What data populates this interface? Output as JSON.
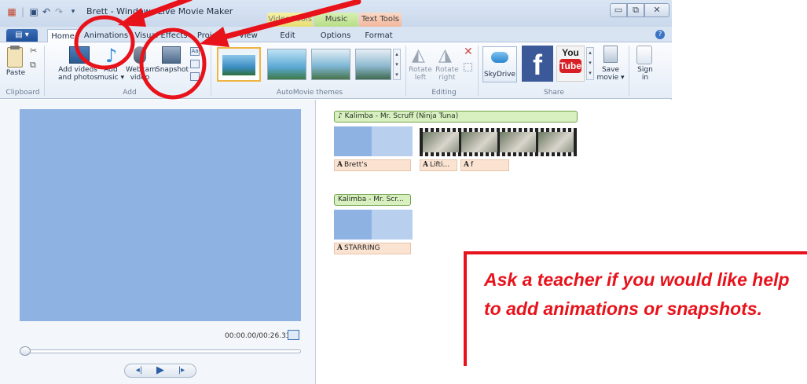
{
  "window": {
    "title": "Brett - Windows Live Movie Maker",
    "context_tabs": [
      "Video Tools",
      "Music Tools",
      "Text Tools"
    ],
    "tabs": [
      "Home",
      "Animations",
      "Visual Effects",
      "Project",
      "View",
      "Edit",
      "Options",
      "Format"
    ],
    "active_tab": "Home"
  },
  "ribbon": {
    "clipboard": {
      "paste": "Paste",
      "group": "Clipboard"
    },
    "add": {
      "add_videos": "Add videos\nand photos",
      "add_music": "Add\nmusic ▾",
      "webcam": "Webcam\nvideo",
      "snapshot": "Snapshot",
      "group": "Add"
    },
    "automovie": {
      "group": "AutoMovie themes"
    },
    "editing": {
      "rotate_left": "Rotate\nleft",
      "rotate_right": "Rotate\nright",
      "group": "Editing"
    },
    "share": {
      "skydrive": "SkyDrive",
      "youtube_top": "You",
      "youtube_bottom": "Tube",
      "save_movie": "Save\nmovie ▾",
      "group": "Share"
    },
    "sign_in": "Sign\nin"
  },
  "preview": {
    "timecode": "00:00.00/00:26.33"
  },
  "storyboard": {
    "music_1": "♪ Kalimba - Mr. Scruff (Ninja Tuna)",
    "captions_row1": [
      "Brett's",
      "Lifti...",
      "f"
    ],
    "music_2": "Kalimba - Mr. Scr...",
    "caption_row2": "STARRING"
  },
  "annotation": {
    "note": "Ask a teacher if you would like help to add animations or snapshots."
  },
  "colors": {
    "annotation_red": "#e8121b",
    "preview_blue": "#8eb3e2"
  }
}
